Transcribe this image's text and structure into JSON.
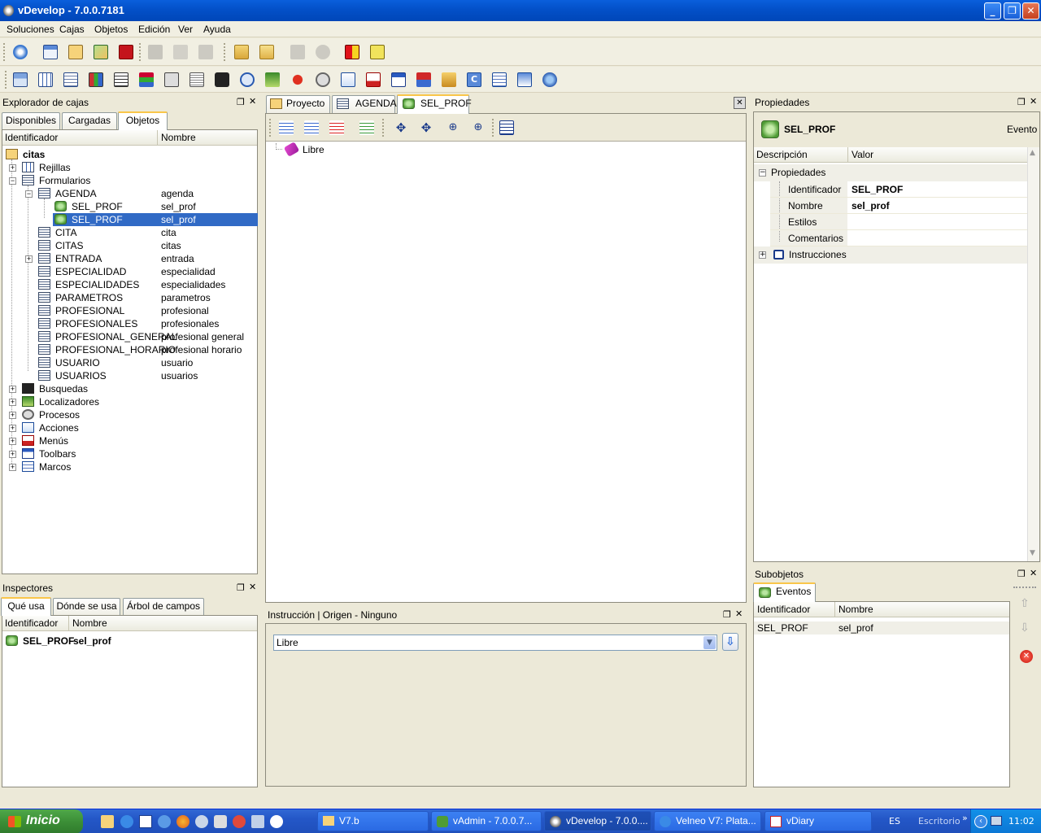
{
  "window": {
    "title": "vDevelop - 7.0.0.7181",
    "min": "_",
    "max": "❐",
    "close": "✕"
  },
  "menu": [
    "Soluciones",
    "Cajas",
    "Objetos",
    "Edición",
    "Ver",
    "Ayuda"
  ],
  "explorer": {
    "title": "Explorador de cajas",
    "tabs": [
      "Disponibles",
      "Cargadas",
      "Objetos"
    ],
    "col_id": "Identificador",
    "col_name": "Nombre",
    "root": "citas",
    "rows": [
      {
        "id": "Rejillas",
        "name": ""
      },
      {
        "id": "Formularios",
        "name": ""
      },
      {
        "id": "AGENDA",
        "name": "agenda"
      },
      {
        "id": "SEL_PROF",
        "name": "sel_prof"
      },
      {
        "id": "SEL_PROF",
        "name": "sel_prof"
      },
      {
        "id": "CITA",
        "name": "cita"
      },
      {
        "id": "CITAS",
        "name": "citas"
      },
      {
        "id": "ENTRADA",
        "name": "entrada"
      },
      {
        "id": "ESPECIALIDAD",
        "name": "especialidad"
      },
      {
        "id": "ESPECIALIDADES",
        "name": "especialidades"
      },
      {
        "id": "PARAMETROS",
        "name": "parametros"
      },
      {
        "id": "PROFESIONAL",
        "name": "profesional"
      },
      {
        "id": "PROFESIONALES",
        "name": "profesionales"
      },
      {
        "id": "PROFESIONAL_GENERAL",
        "name": "profesional general"
      },
      {
        "id": "PROFESIONAL_HORARIO",
        "name": "profesional horario"
      },
      {
        "id": "USUARIO",
        "name": "usuario"
      },
      {
        "id": "USUARIOS",
        "name": "usuarios"
      },
      {
        "id": "Busquedas",
        "name": ""
      },
      {
        "id": "Localizadores",
        "name": ""
      },
      {
        "id": "Procesos",
        "name": ""
      },
      {
        "id": "Acciones",
        "name": ""
      },
      {
        "id": "Menús",
        "name": ""
      },
      {
        "id": "Toolbars",
        "name": ""
      },
      {
        "id": "Marcos",
        "name": ""
      }
    ]
  },
  "inspectors": {
    "title": "Inspectores",
    "tabs": [
      "Qué usa",
      "Dónde se usa",
      "Árbol de campos"
    ],
    "col_id": "Identificador",
    "col_name": "Nombre",
    "row_id": "SEL_PROF",
    "row_name": "sel_prof"
  },
  "editor": {
    "tabs": [
      "Proyecto",
      "AGENDA",
      "SEL_PROF"
    ],
    "tree_item": "Libre",
    "instr_title": "Instrucción | Origen - Ninguno",
    "combo_value": "Libre"
  },
  "properties": {
    "title": "Propiedades",
    "object": "SEL_PROF",
    "type": "Evento",
    "col_desc": "Descripción",
    "col_val": "Valor",
    "group": "Propiedades",
    "rows": [
      {
        "k": "Identificador",
        "v": "SEL_PROF"
      },
      {
        "k": "Nombre",
        "v": "sel_prof"
      },
      {
        "k": "Estilos",
        "v": ""
      },
      {
        "k": "Comentarios",
        "v": ""
      }
    ],
    "instr": "Instrucciones"
  },
  "subobjects": {
    "title": "Subobjetos",
    "tab": "Eventos",
    "col_id": "Identificador",
    "col_name": "Nombre",
    "row_id": "SEL_PROF",
    "row_name": "sel_prof"
  },
  "taskbar": {
    "start": "Inicio",
    "tasks": [
      "V7.b",
      "vAdmin - 7.0.0.7...",
      "vDevelop - 7.0.0....",
      "Velneo V7: Plata...",
      "vDiary"
    ],
    "lang": "ES",
    "desk": "Escritorio",
    "clock": "11:02"
  }
}
